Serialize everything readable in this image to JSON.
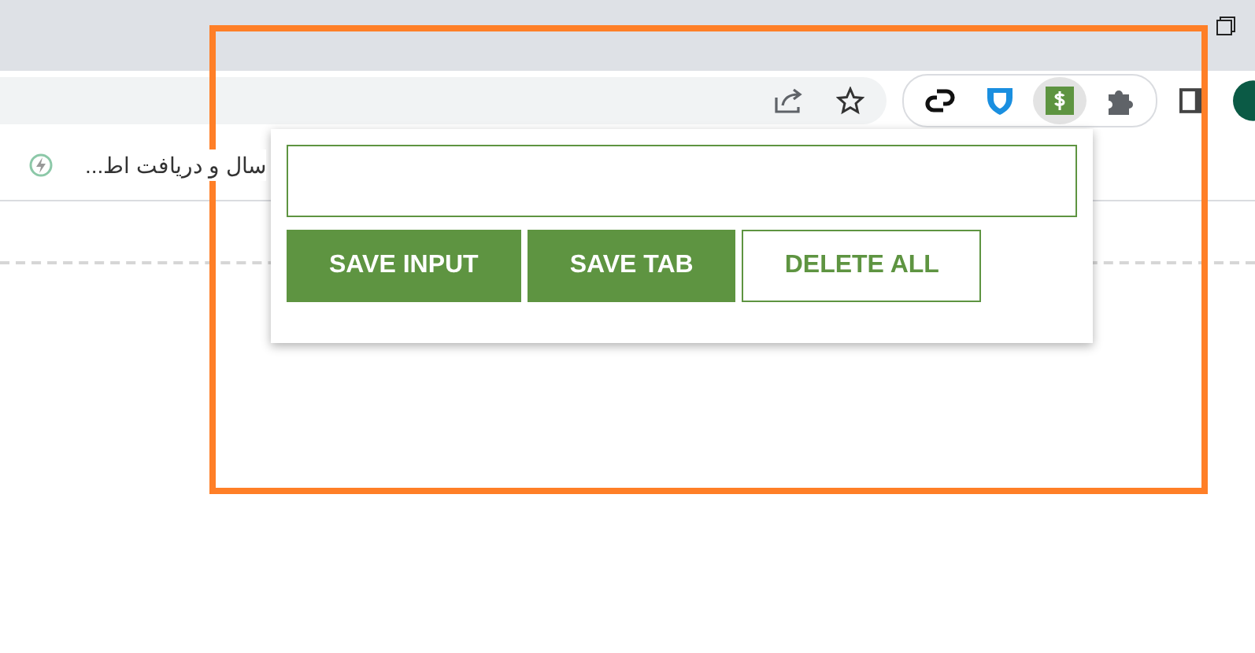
{
  "toolbar": {
    "extensions": [
      {
        "kind": "link",
        "selected": false
      },
      {
        "kind": "shield",
        "selected": false
      },
      {
        "kind": "dollar",
        "selected": true
      },
      {
        "kind": "puzzle",
        "selected": false
      }
    ]
  },
  "bookmarks": [
    {
      "label": "سال و دریافت اط..."
    }
  ],
  "popup": {
    "buttons": [
      {
        "label": "SAVE INPUT",
        "kind": "filled"
      },
      {
        "label": "SAVE TAB",
        "kind": "filled"
      },
      {
        "label": "DELETE ALL",
        "kind": "outline"
      }
    ]
  }
}
